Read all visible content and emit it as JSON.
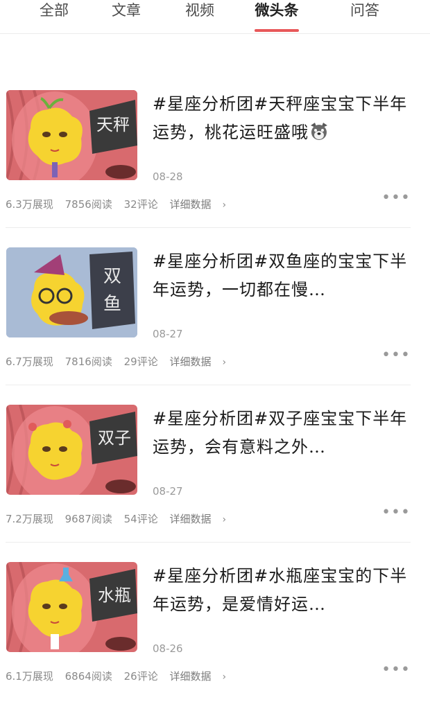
{
  "tabs": [
    {
      "label": "全部",
      "active": false
    },
    {
      "label": "文章",
      "active": false
    },
    {
      "label": "视频",
      "active": false
    },
    {
      "label": "微头条",
      "active": true
    },
    {
      "label": "问答",
      "active": false
    }
  ],
  "items": [
    {
      "title": "#星座分析团#天秤座宝宝下半年运势，桃花运旺盛哦",
      "emoji_icon": "dog-face-emoji-icon",
      "date": "08-28",
      "impressions": "6.3万展现",
      "reads": "7856阅读",
      "comments": "32评论",
      "detail": "详细数据",
      "thumb_sign": "天秤",
      "thumb_accent": "#7ac143"
    },
    {
      "title": "#星座分析团#双鱼座的宝宝下半年运势，一切都在慢…",
      "emoji_icon": "",
      "date": "08-27",
      "impressions": "6.7万展现",
      "reads": "7816阅读",
      "comments": "29评论",
      "detail": "详细数据",
      "thumb_sign": "双鱼",
      "thumb_accent": "#a23f77"
    },
    {
      "title": "#星座分析团#双子座宝宝下半年运势，会有意料之外…",
      "emoji_icon": "",
      "date": "08-27",
      "impressions": "7.2万展现",
      "reads": "9687阅读",
      "comments": "54评论",
      "detail": "详细数据",
      "thumb_sign": "双子",
      "thumb_accent": "#e05b5b"
    },
    {
      "title": "#星座分析团#水瓶座宝宝的下半年运势，是爱情好运…",
      "emoji_icon": "",
      "date": "08-26",
      "impressions": "6.1万展现",
      "reads": "6864阅读",
      "comments": "26评论",
      "detail": "详细数据",
      "thumb_sign": "水瓶",
      "thumb_accent": "#5ab0e0"
    }
  ],
  "colors": {
    "accent": "#e8585a",
    "curtain": "#d86a6e",
    "mascot": "#f6d330"
  }
}
